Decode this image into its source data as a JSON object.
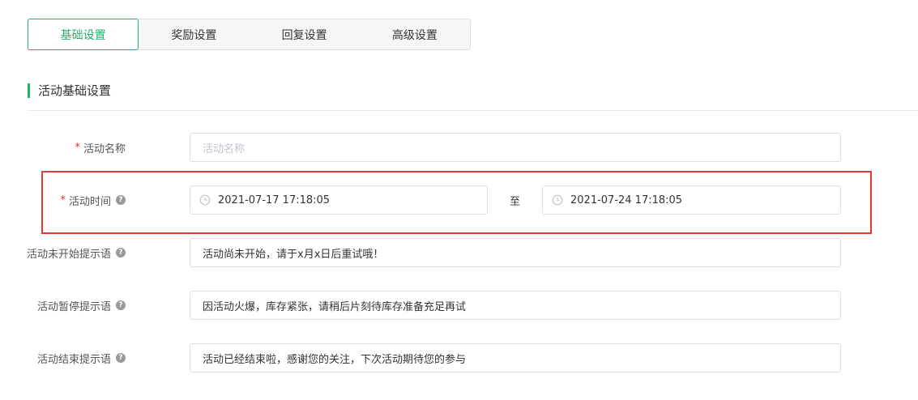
{
  "tabs": [
    {
      "label": "基础设置",
      "active": true
    },
    {
      "label": "奖励设置",
      "active": false
    },
    {
      "label": "回复设置",
      "active": false
    },
    {
      "label": "高级设置",
      "active": false
    }
  ],
  "section": {
    "title": "活动基础设置"
  },
  "form": {
    "name": {
      "label": "活动名称",
      "required_mark": "*",
      "placeholder": "活动名称",
      "value": ""
    },
    "time": {
      "label": "活动时间",
      "required_mark": "*",
      "help_icon": "question-circle-icon",
      "start": "2021-07-17 17:18:05",
      "separator": "至",
      "end": "2021-07-24 17:18:05"
    },
    "not_started": {
      "label": "活动未开始提示语",
      "help_icon": "question-circle-icon",
      "value": "活动尚未开始，请于x月x日后重试哦！"
    },
    "paused": {
      "label": "活动暂停提示语",
      "help_icon": "question-circle-icon",
      "value": "因活动火爆，库存紧张，请稍后片刻待库存准备充足再试"
    },
    "ended": {
      "label": "活动结束提示语",
      "help_icon": "question-circle-icon",
      "value": "活动已经结束啦，感谢您的关注，下次活动期待您的参与"
    }
  },
  "colors": {
    "accent": "#20b36e",
    "required": "#f5222d",
    "highlight": "#e53935"
  }
}
